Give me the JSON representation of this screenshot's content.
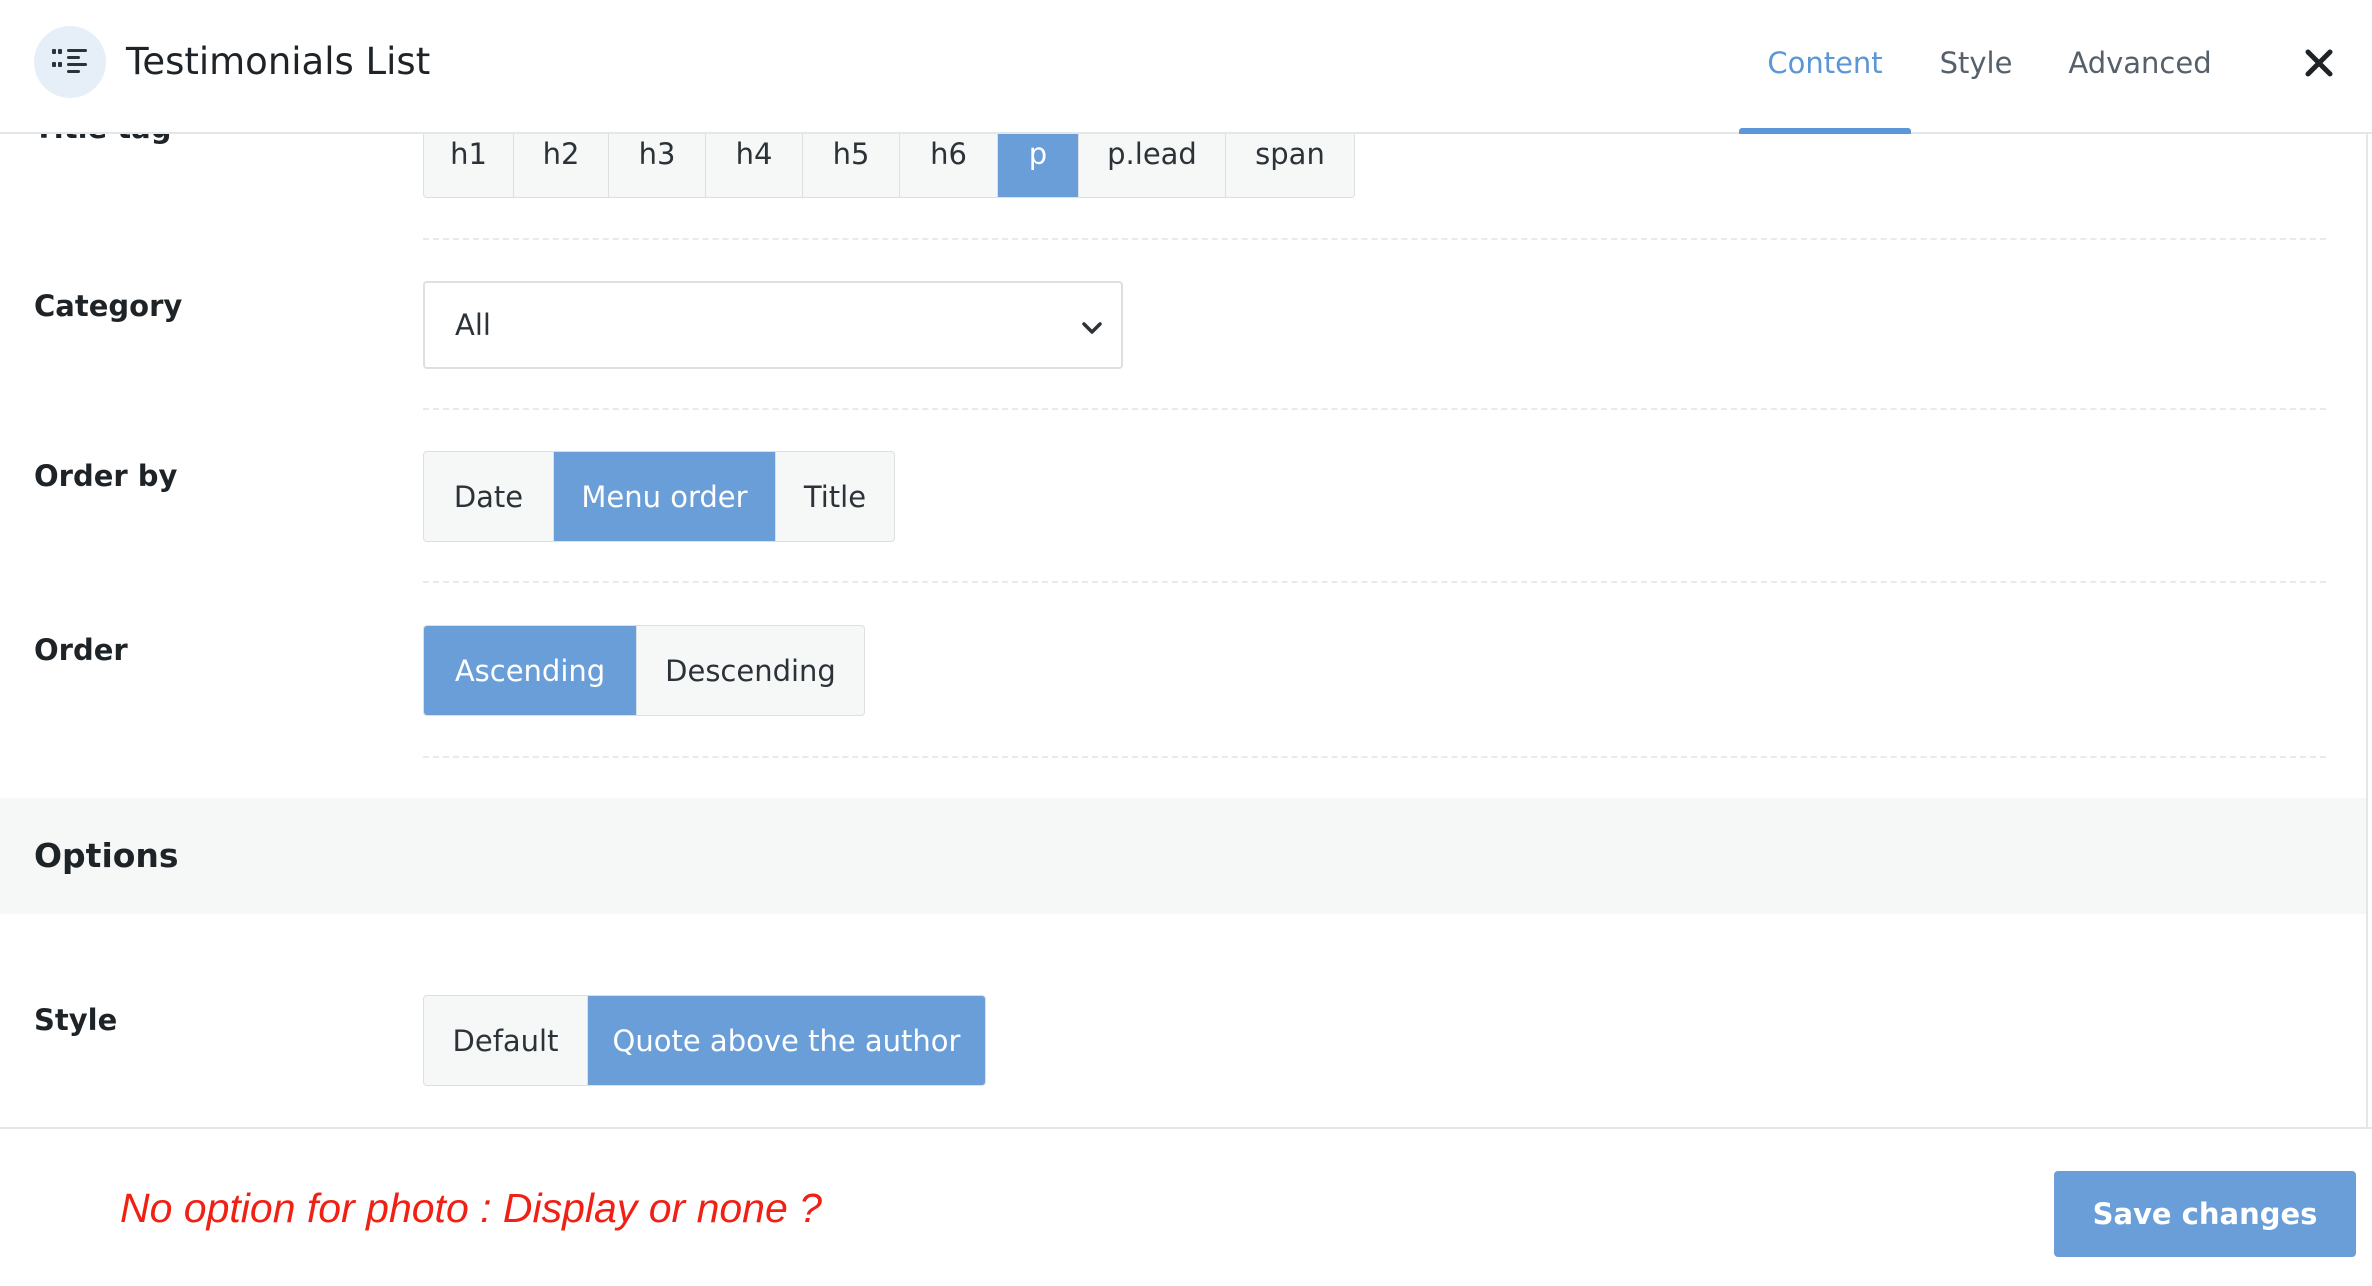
{
  "header": {
    "title": "Testimonials List",
    "tabs": [
      {
        "label": "Content",
        "active": true
      },
      {
        "label": "Style",
        "active": false
      },
      {
        "label": "Advanced",
        "active": false
      }
    ],
    "widget_icon": "testimonial-list-icon",
    "close_icon": "close-icon"
  },
  "form": {
    "title_tag": {
      "label": "Title tag",
      "options": [
        "h1",
        "h2",
        "h3",
        "h4",
        "h5",
        "h6",
        "p",
        "p.lead",
        "span"
      ],
      "selected": "p"
    },
    "category": {
      "label": "Category",
      "value": "All"
    },
    "order_by": {
      "label": "Order by",
      "options": [
        "Date",
        "Menu order",
        "Title"
      ],
      "selected": "Menu order"
    },
    "order": {
      "label": "Order",
      "options": [
        "Ascending",
        "Descending"
      ],
      "selected": "Ascending"
    }
  },
  "options_section": {
    "title": "Options",
    "style": {
      "label": "Style",
      "options": [
        "Default",
        "Quote above the author"
      ],
      "selected": "Quote above the author"
    }
  },
  "footer": {
    "note": "No option for photo : Display or none ?",
    "save_label": "Save changes"
  },
  "colors": {
    "accent": "#5b96d6",
    "active_segment": "#6a9ed8",
    "note_red": "#f02014",
    "section_band": "#f6f7f7"
  }
}
